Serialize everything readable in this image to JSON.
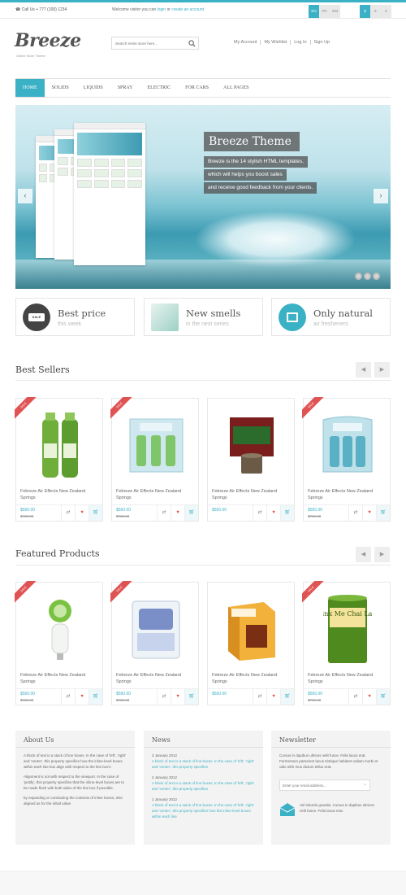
{
  "topbar": {
    "phone": "Call Us + 777 (100) 1234",
    "welcome_prefix": "Welcome visitor you can",
    "login": "login",
    "or": "or",
    "create": "create an account.",
    "languages": [
      "EN",
      "FR",
      "GM"
    ],
    "active_language": "EN",
    "currencies": [
      "$",
      "€",
      "£"
    ],
    "active_currency": "$"
  },
  "header": {
    "logo": "Breeze",
    "tagline": "Online Store Theme",
    "search_placeholder": "Search entire store here...",
    "account_links": [
      "My Account",
      "My Wishlist",
      "Log In",
      "Sign Up"
    ]
  },
  "nav": {
    "items": [
      "HOME",
      "SOLIDS",
      "LIQUIDS",
      "SPRAY",
      "ELECTRIC",
      "FOR CARS",
      "ALL PAGES"
    ],
    "active": "HOME"
  },
  "slider": {
    "title": "Breeze Theme",
    "lines": [
      "Breeze is the 14 stylish HTML templates,",
      "which will helps you boost sales",
      "and receive good feedback from your clients."
    ],
    "prev": "‹",
    "next": "›",
    "slides": 3
  },
  "promos": [
    {
      "title": "Best price",
      "subtitle": "this week",
      "icon": "sale-icon",
      "badge": "SALE"
    },
    {
      "title": "New smells",
      "subtitle": "in the next series",
      "icon": "product-box-icon"
    },
    {
      "title": "Only natural",
      "subtitle": "air fresheners",
      "icon": "freshener-icon"
    }
  ],
  "best_sellers": {
    "title": "Best Sellers",
    "products": [
      {
        "name": "Febreze Air Effects New Zealand Springs",
        "price": "$560.00",
        "old_price": "$725.00",
        "sale": true,
        "image": "spray-bottles"
      },
      {
        "name": "Febreze Air Effects New Zealand Springs",
        "price": "$560.00",
        "old_price": "$725.00",
        "sale": true,
        "image": "plugin-pack"
      },
      {
        "name": "Febreze Air Effects New Zealand Springs",
        "price": "$560.00",
        "old_price": "",
        "sale": false,
        "image": "candle-box"
      },
      {
        "name": "Febreze Air Effects New Zealand Springs",
        "price": "$560.00",
        "old_price": "$725.00",
        "sale": true,
        "image": "blue-pack"
      }
    ]
  },
  "featured": {
    "title": "Featured Products",
    "products": [
      {
        "name": "Febreze Air Effects New Zealand Springs",
        "price": "$560.00",
        "old_price": "$725.00",
        "sale": true,
        "image": "plugin-device"
      },
      {
        "name": "Febreze Air Effects New Zealand Springs",
        "price": "$560.00",
        "old_price": "$725.00",
        "sale": true,
        "image": "oil-refill"
      },
      {
        "name": "Febreze Air Effects New Zealand Springs",
        "price": "$560.00",
        "old_price": "",
        "sale": false,
        "image": "home-box"
      },
      {
        "name": "Febreze Air Effects New Zealand Springs",
        "price": "$560.00",
        "old_price": "$725.00",
        "sale": true,
        "image": "tea-tin"
      }
    ],
    "tea_tin_text": "Drink Me Chai Latte"
  },
  "sale_label": "SALE",
  "footer": {
    "about": {
      "title": "About Us",
      "p1": "A block of text is a stack of line boxes. In the case of 'left', 'right' and 'center', this property specifies how the inline-level boxes within each line box align with respect to the line box's",
      "p2": "Alignment is not with respect to the viewport. In the case of 'justify', this property specifies that the inline-level boxes are to be made flush with both sides of the line box if possible.",
      "p3": "by expanding or contracting the contents of inline boxes, else aligned as for the initial value."
    },
    "news": {
      "title": "News",
      "items": [
        {
          "date": "3 January 2012",
          "text": "A block of text is a stack of line boxes. In the case of 'left', 'right' and 'center', this property specifies"
        },
        {
          "date": "2 January 2012",
          "text": "A block of text is a stack of line boxes. In the case of 'left', 'right' and 'center', this property specifies"
        },
        {
          "date": "1 January 2012",
          "text": "A block of text is a stack of line boxes. In the case of 'left', 'right' and 'center', this property specifies how the inline-level boxes within each line"
        }
      ]
    },
    "newsletter": {
      "title": "Newsletter",
      "text": "Cursus in dapibus ultrices velit fusce. Felis lacus erat. Fermentum parturient lacus tristique habitant nullam morbi et odio nibh mus dictum tellus erat.",
      "placeholder": "Enter your email address...",
      "note": "Vel lobortis gravida. Cursus in dapibus ultrices velit fusce. Felis lacus erat."
    }
  },
  "colors": {
    "accent": "#3bb1c5",
    "sale": "#e05353",
    "nav_bg": "#3bb1c5"
  }
}
